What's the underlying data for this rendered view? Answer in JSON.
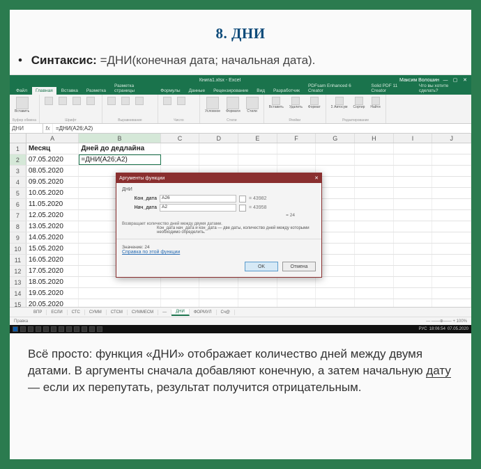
{
  "title": "8. ДНИ",
  "syntax": {
    "label": "Синтаксис:",
    "value": "=ДНИ(конечная дата; начальная дата)."
  },
  "excel": {
    "title_mid": "Книга1.xlsx - Excel",
    "title_user": "Максим Волошин",
    "tabs": [
      "Файл",
      "Главная",
      "Вставка",
      "Разметка",
      "Разметка страницы",
      "Формулы",
      "Данные",
      "Рецензирование",
      "Вид",
      "Разработчик",
      "PDFsam Enhanced 6 Creator",
      "Solid PDF 11 Creator",
      "Что вы хотите сделать?"
    ],
    "ribbon_groups": [
      "Буфер обмена",
      "Шрифт",
      "Выравнивание",
      "Число",
      "Стили",
      "Ячейки",
      "Редактирование"
    ],
    "name_box": "ДНИ",
    "formula": "=ДНИ(A26;A2)",
    "cols": [
      "A",
      "B",
      "C",
      "D",
      "E",
      "F",
      "G",
      "H",
      "I",
      "J"
    ],
    "headers": {
      "A": "Месяц",
      "B": "Дней до дедлайна"
    },
    "rows": [
      {
        "n": 1,
        "A": "Месяц",
        "B": "Дней до дедлайна"
      },
      {
        "n": 2,
        "A": "07.05.2020",
        "B": "=ДНИ(A26;A2)",
        "sel": true
      },
      {
        "n": 3,
        "A": "08.05.2020",
        "B": ""
      },
      {
        "n": 4,
        "A": "09.05.2020",
        "B": ""
      },
      {
        "n": 5,
        "A": "10.05.2020",
        "B": ""
      },
      {
        "n": 6,
        "A": "11.05.2020",
        "B": ""
      },
      {
        "n": 7,
        "A": "12.05.2020",
        "B": ""
      },
      {
        "n": 8,
        "A": "13.05.2020",
        "B": ""
      },
      {
        "n": 9,
        "A": "14.05.2020",
        "B": ""
      },
      {
        "n": 10,
        "A": "15.05.2020",
        "B": ""
      },
      {
        "n": 11,
        "A": "16.05.2020",
        "B": ""
      },
      {
        "n": 12,
        "A": "17.05.2020",
        "B": ""
      },
      {
        "n": 13,
        "A": "18.05.2020",
        "B": ""
      },
      {
        "n": 14,
        "A": "19.05.2020",
        "B": ""
      },
      {
        "n": 15,
        "A": "20.05.2020",
        "B": ""
      }
    ],
    "sheet_tabs": [
      "ВПР",
      "ЕСЛИ",
      "СТС",
      "СУММ",
      "СТСМ",
      "СУММЕСМ",
      "—",
      "ДНИ",
      "ФОРМУЛ",
      "Сч@"
    ],
    "sheet_active": "ДНИ",
    "status_left": "Правка",
    "taskbar_time": "18:06:54",
    "taskbar_date": "07.05.2020",
    "taskbar_lang": "РУС"
  },
  "dialog": {
    "title": "Аргументы функции",
    "fn": "ДНИ",
    "rows": [
      {
        "label": "Кон_дата",
        "input": "A26",
        "eval": "= 43982"
      },
      {
        "label": "Нач_дата",
        "input": "A2",
        "eval": "= 43958"
      }
    ],
    "mid_eq": "= 24",
    "desc": "Возвращает количество дней между двумя датами.",
    "hint": "Кон_дата   нач_дата и кон_дата — две даты, количество дней между которыми необходимо определить.",
    "result": "Значение: 24",
    "help": "Справка по этой функции",
    "ok": "OK",
    "cancel": "Отмена"
  },
  "footer": {
    "p1a": "Всё просто: функция «ДНИ» отображает количество дней между двумя датами. В аргументы сначала добавляют конечную, а затем начальную ",
    "p1b": "дату",
    "p1c": " — если их перепутать, результат получится отрицательным."
  }
}
